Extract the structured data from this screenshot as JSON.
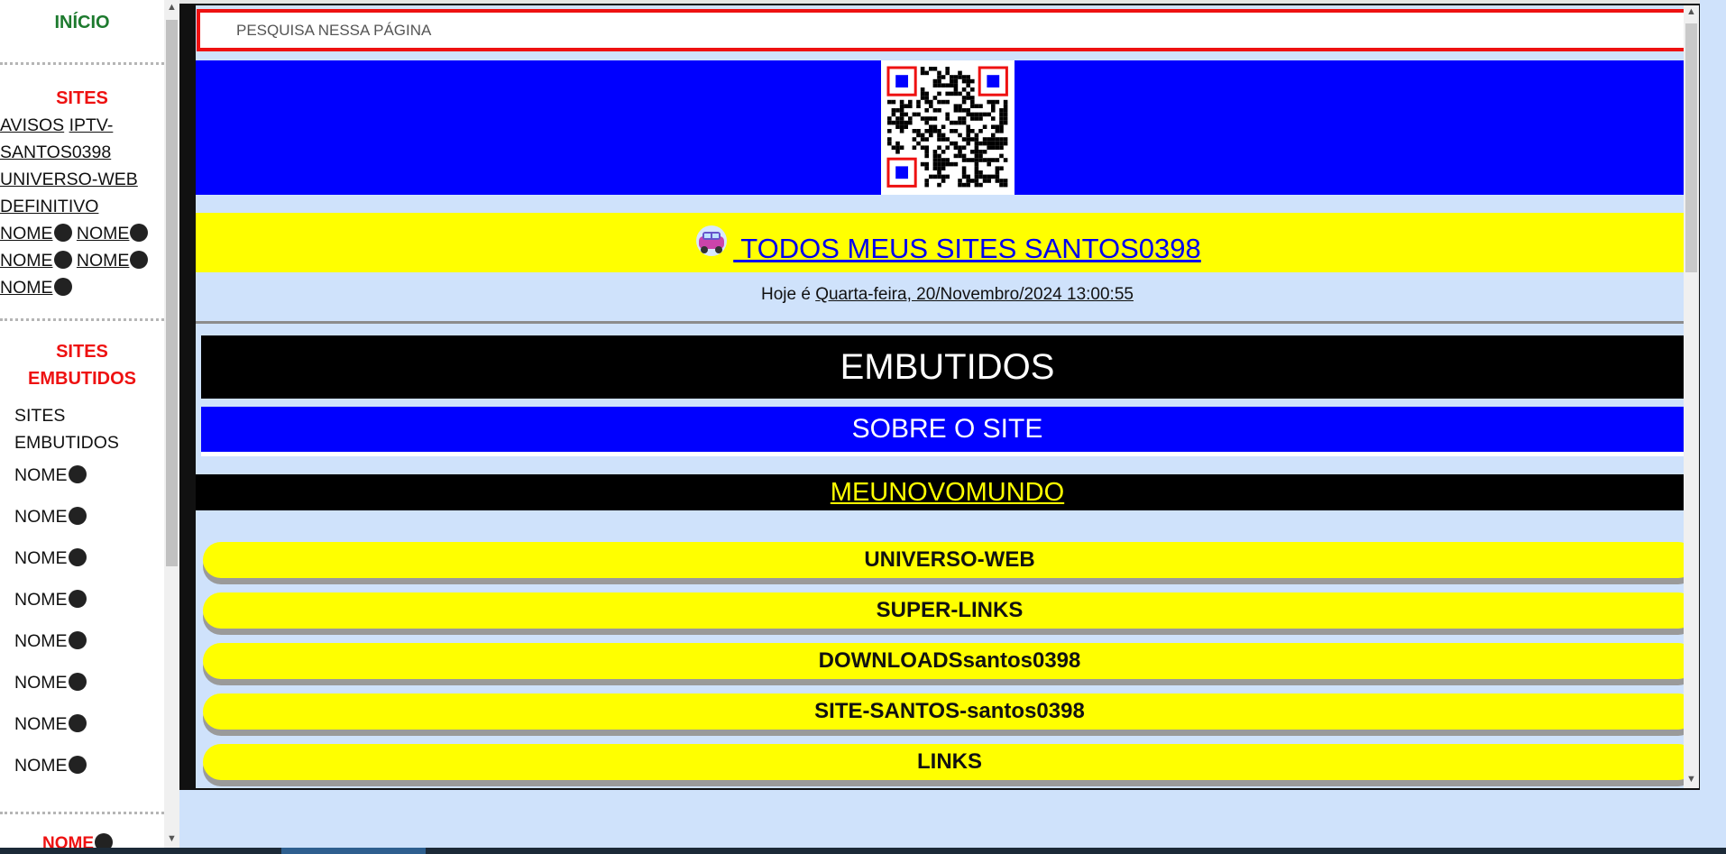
{
  "sidebar": {
    "inicio": "INÍCIO",
    "sites_heading": "SITES",
    "links": [
      "AVISOS",
      "IPTV-",
      "SANTOS0398",
      "UNIVERSO-WEB",
      "DEFINITIVO",
      "NOME",
      "NOME",
      "NOME",
      "NOME",
      "NOME"
    ],
    "embutidos_heading_1": "SITES",
    "embutidos_heading_2": "EMBUTIDOS",
    "embutidos_title_1": "SITES",
    "embutidos_title_2": "EMBUTIDOS",
    "embutidos_items": [
      "NOME",
      "NOME",
      "NOME",
      "NOME",
      "NOME",
      "NOME",
      "NOME",
      "NOME"
    ],
    "bottom_item": "NOME"
  },
  "search": {
    "placeholder": "PESQUISA NESSA PÁGINA"
  },
  "banner": {
    "sites_link": " TODOS MEUS SITES SANTOS0398",
    "date_prefix": "Hoje é ",
    "date_value": "Quarta-feira, 20/Novembro/2024 13:00:55"
  },
  "sections": {
    "embutidos": "EMBUTIDOS",
    "sobre": "SOBRE O SITE",
    "meunovomundo": "MEUNOVOMUNDO"
  },
  "buttons": [
    "UNIVERSO-WEB",
    "SUPER-LINKS",
    "DOWNLOADSsantos0398",
    "SITE-SANTOS-santos0398",
    "LINKS"
  ],
  "colors": {
    "background": "#cfe2fb",
    "banner_blue": "#0000ff",
    "highlight_yellow": "#ffff00",
    "sidebar_red": "#ee1111",
    "inicio_green": "#1d7a2e"
  }
}
